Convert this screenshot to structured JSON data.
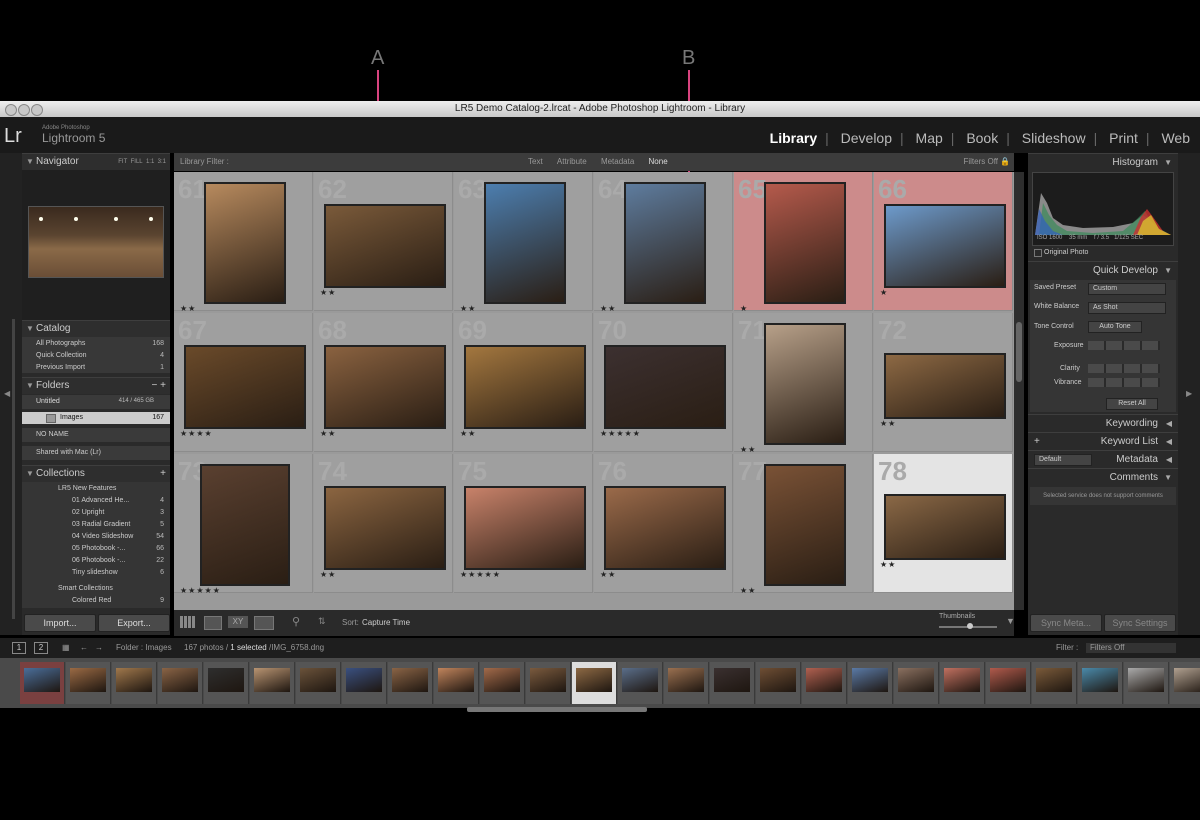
{
  "callouts": {
    "a": "A",
    "b": "B"
  },
  "window": {
    "title": "LR5 Demo Catalog-2.lrcat - Adobe Photoshop Lightroom - Library"
  },
  "identity": {
    "logo": "Lr",
    "brand_small": "Adobe Photoshop",
    "brand": "Lightroom 5"
  },
  "modules": [
    "Library",
    "Develop",
    "Map",
    "Book",
    "Slideshow",
    "Print",
    "Web"
  ],
  "active_module": "Library",
  "left": {
    "navigator": {
      "title": "Navigator",
      "zoom": [
        "FIT",
        "FILL",
        "1:1",
        "3:1"
      ]
    },
    "catalog": {
      "title": "Catalog",
      "items": [
        {
          "label": "All Photographs",
          "count": "168"
        },
        {
          "label": "Quick Collection",
          "count": "4"
        },
        {
          "label": "Previous Import",
          "count": "1"
        }
      ]
    },
    "folders": {
      "title": "Folders",
      "drive1": "Untitled",
      "drive1_size": "414 / 465 GB",
      "folder": "Images",
      "folder_count": "167",
      "drive2": "NO NAME",
      "drive3": "Shared with Mac (Lr)"
    },
    "collections": {
      "title": "Collections",
      "set": "LR5 New Features",
      "items": [
        {
          "label": "01 Advanced He...",
          "count": "4"
        },
        {
          "label": "02 Upright",
          "count": "3"
        },
        {
          "label": "03 Radial Gradient",
          "count": "5"
        },
        {
          "label": "04 Video Slideshow",
          "count": "54"
        },
        {
          "label": "05 Photobook -...",
          "count": "66"
        },
        {
          "label": "06 Photobook -...",
          "count": "22"
        },
        {
          "label": "Tiny slideshow",
          "count": "6"
        }
      ],
      "smart_set": "Smart Collections",
      "smart_item": "Colored Red",
      "smart_count": "9"
    },
    "import_label": "Import...",
    "export_label": "Export..."
  },
  "filter_bar": {
    "label": "Library Filter :",
    "options": [
      "Text",
      "Attribute",
      "Metadata",
      "None"
    ],
    "filters": "Filters Off"
  },
  "grid": {
    "cells": [
      {
        "num": "61",
        "stars": "★★",
        "color": "#b78a5e",
        "bg": "#9f9f9f"
      },
      {
        "num": "62",
        "stars": "★★",
        "color": "#7a5a3a",
        "bg": "#9f9f9f"
      },
      {
        "num": "63",
        "stars": "★★",
        "color": "#4c7eaf",
        "bg": "#9f9f9f"
      },
      {
        "num": "64",
        "stars": "★★",
        "color": "#5e7c9e",
        "bg": "#9f9f9f"
      },
      {
        "num": "65",
        "stars": "★",
        "color": "#b55a4c",
        "bg": "#cc8b8b"
      },
      {
        "num": "66",
        "stars": "★",
        "color": "#6d9acb",
        "bg": "#cc8b8b"
      },
      {
        "num": "67",
        "stars": "★★★★",
        "color": "#6a4a2a",
        "bg": "#9f9f9f"
      },
      {
        "num": "68",
        "stars": "★★",
        "color": "#8a6240",
        "bg": "#9f9f9f"
      },
      {
        "num": "69",
        "stars": "★★",
        "color": "#a3773f",
        "bg": "#9f9f9f"
      },
      {
        "num": "70",
        "stars": "★★★★★",
        "color": "#3c3030",
        "bg": "#9f9f9f"
      },
      {
        "num": "71",
        "stars": "★★",
        "color": "#b7a089",
        "bg": "#9f9f9f"
      },
      {
        "num": "72",
        "stars": "★★",
        "color": "#8d6944",
        "bg": "#9f9f9f"
      },
      {
        "num": "73",
        "stars": "★★★★★",
        "color": "#5a4030",
        "bg": "#9f9f9f"
      },
      {
        "num": "74",
        "stars": "★★",
        "color": "#8b6541",
        "bg": "#9f9f9f"
      },
      {
        "num": "75",
        "stars": "★★★★★",
        "color": "#c8826a",
        "bg": "#9f9f9f"
      },
      {
        "num": "76",
        "stars": "★★",
        "color": "#9a6a4a",
        "bg": "#9f9f9f"
      },
      {
        "num": "77",
        "stars": "★★",
        "color": "#7a5236",
        "bg": "#9f9f9f"
      },
      {
        "num": "78",
        "stars": "★★",
        "color": "#8a6846",
        "bg": "#e4e4e4"
      }
    ]
  },
  "toolbar": {
    "sort_label": "Sort:",
    "sort_value": "Capture Time",
    "thumbnails": "Thumbnails"
  },
  "right": {
    "histogram": {
      "title": "Histogram",
      "iso": "ISO 1600",
      "focal": "35 mm",
      "aperture": "f / 3.5",
      "shutter": "1/125 SEC",
      "original": "Original Photo"
    },
    "quick_develop": {
      "title": "Quick Develop",
      "saved_preset": "Saved Preset",
      "preset_value": "Custom",
      "white_balance": "White Balance",
      "wb_value": "As Shot",
      "tone_control": "Tone Control",
      "auto_tone": "Auto Tone",
      "exposure": "Exposure",
      "clarity": "Clarity",
      "vibrance": "Vibrance",
      "reset": "Reset All"
    },
    "keywording": "Keywording",
    "keyword_list": "Keyword List",
    "metadata": "Metadata",
    "metadata_preset": "Default",
    "comments": "Comments",
    "comments_note": "Selected service does not support comments",
    "sync_meta": "Sync Meta...",
    "sync_settings": "Sync Settings"
  },
  "filmstrip_bar": {
    "screen1": "1",
    "screen2": "2",
    "path": "Folder : Images",
    "count": "167 photos /",
    "selected": "1 selected",
    "file": "/IMG_6758.dng",
    "filter_label": "Filter :",
    "filter_value": "Filters Off"
  },
  "filmstrip": {
    "colors": [
      "#4a6e9a",
      "#9a6a44",
      "#a0784c",
      "#8a6446",
      "#2e2e2e",
      "#b89472",
      "#6a523a",
      "#3a5080",
      "#8a6446",
      "#c0845c",
      "#a26a4a",
      "#7a5a3e",
      "#8d6944",
      "#5a6e8a",
      "#9a7050",
      "#3a3030",
      "#6e4e34",
      "#b06050",
      "#5a7aa6",
      "#8a7060",
      "#c07060",
      "#b05a4c",
      "#7a5a3a",
      "#4a8aaa",
      "#aaaaaa",
      "#b0a090",
      "#9a6a50"
    ]
  }
}
